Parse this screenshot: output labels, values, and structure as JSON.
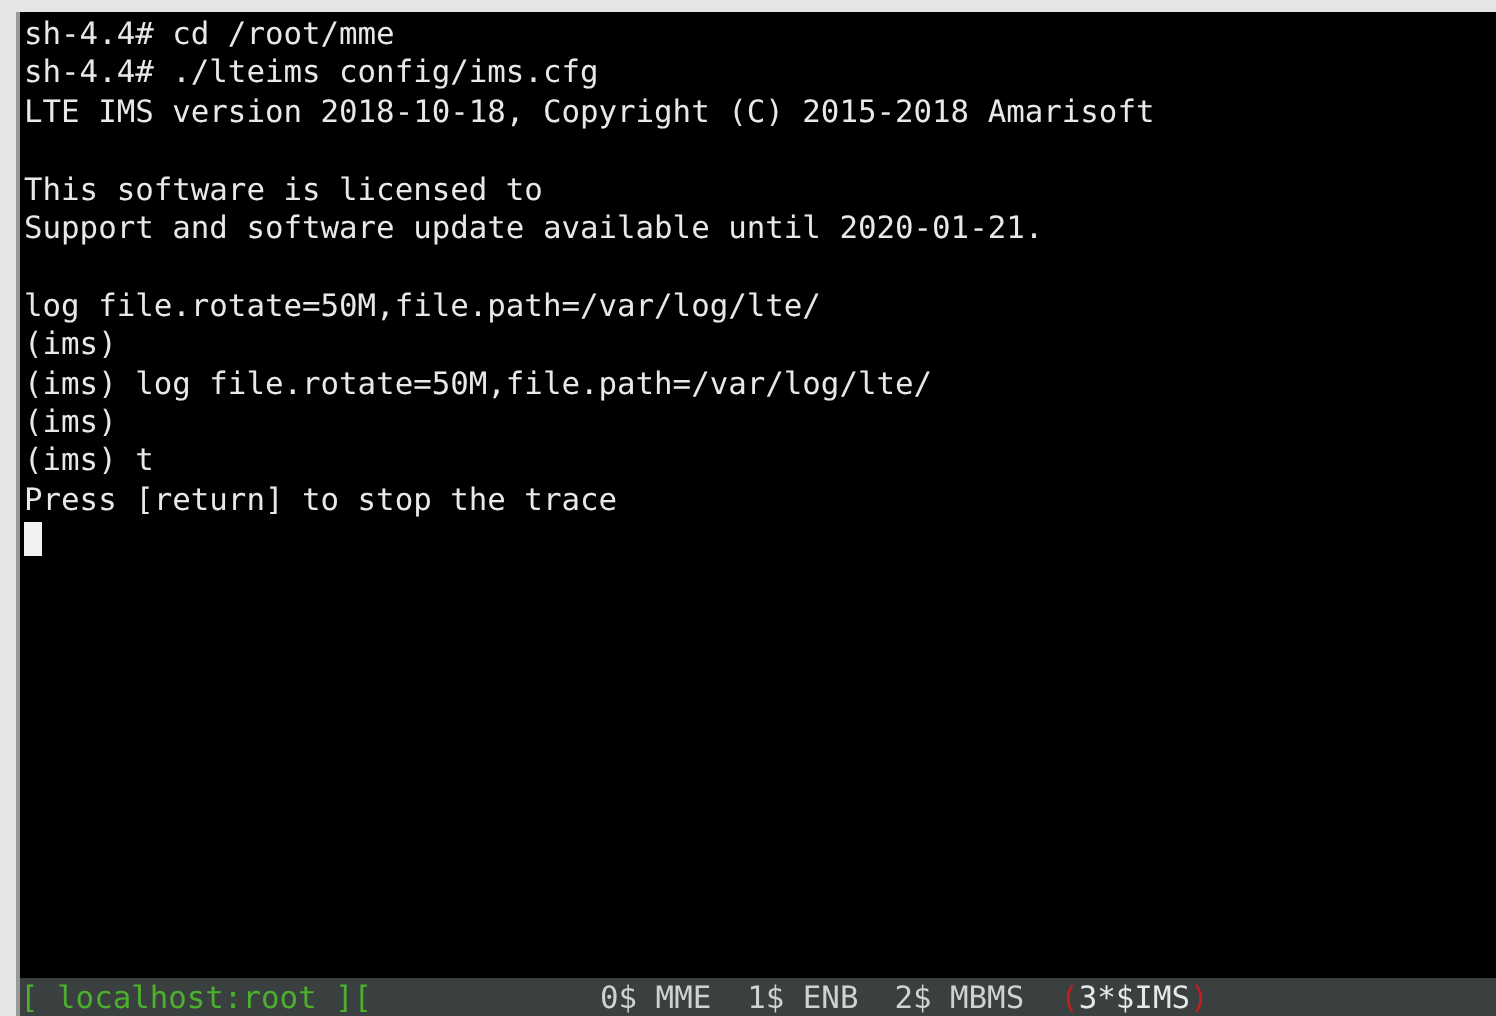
{
  "terminal": {
    "lines": [
      {
        "kind": "text",
        "text": "sh-4.4# cd /root/mme"
      },
      {
        "kind": "text",
        "text": "sh-4.4# ./lteims config/ims.cfg"
      },
      {
        "kind": "text",
        "text": "LTE IMS version 2018-10-18, Copyright (C) 2015-2018 Amarisoft"
      },
      {
        "kind": "blank"
      },
      {
        "kind": "text",
        "text": "This software is licensed to"
      },
      {
        "kind": "text",
        "text": "Support and software update available until 2020-01-21."
      },
      {
        "kind": "blank"
      },
      {
        "kind": "text",
        "text": "log file.rotate=50M,file.path=/var/log/lte/"
      },
      {
        "kind": "text",
        "text": "(ims)"
      },
      {
        "kind": "text",
        "text": "(ims) log file.rotate=50M,file.path=/var/log/lte/"
      },
      {
        "kind": "text",
        "text": "(ims)"
      },
      {
        "kind": "text",
        "text": "(ims) t"
      },
      {
        "kind": "text",
        "text": "Press [return] to stop the trace"
      },
      {
        "kind": "cursor"
      }
    ]
  },
  "status_bar": {
    "host": "[ localhost:root ][",
    "windows": [
      {
        "label": "0$ MME",
        "selected": false
      },
      {
        "label": "1$ ENB",
        "selected": false
      },
      {
        "label": "2$ MBMS",
        "selected": false
      },
      {
        "label": "3*$IMS",
        "selected": true
      }
    ],
    "open_mark": "(",
    "close_mark": ")"
  }
}
